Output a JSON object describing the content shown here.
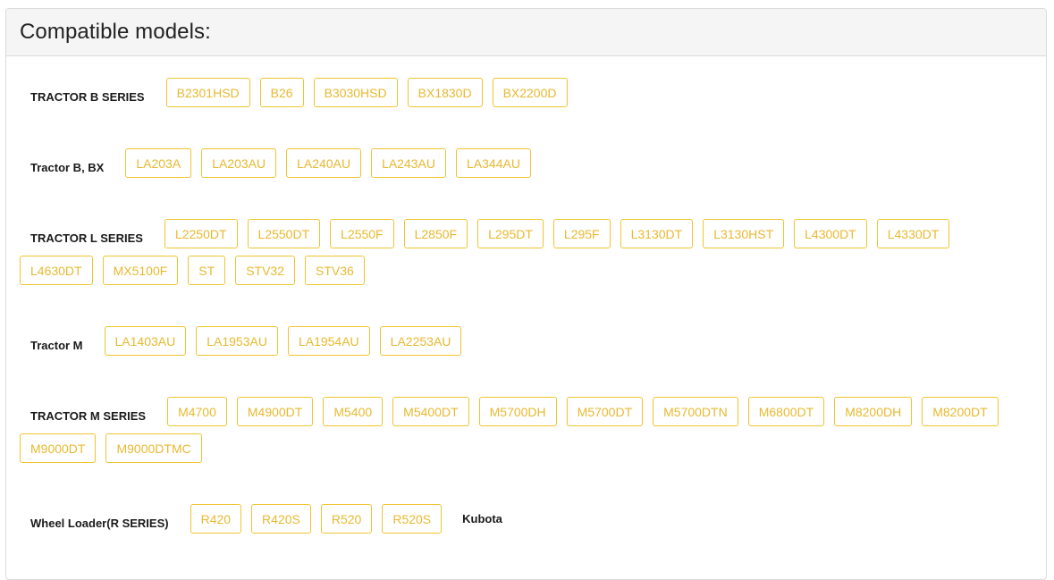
{
  "panel": {
    "title": "Compatible models:"
  },
  "series": [
    {
      "label": "TRACTOR B SERIES",
      "models": [
        "B2301HSD",
        "B26",
        "B3030HSD",
        "BX1830D",
        "BX2200D"
      ]
    },
    {
      "label": "Tractor B, BX",
      "models": [
        "LA203A",
        "LA203AU",
        "LA240AU",
        "LA243AU",
        "LA344AU"
      ]
    },
    {
      "label": "TRACTOR L SERIES",
      "models": [
        "L2250DT",
        "L2550DT",
        "L2550F",
        "L2850F",
        "L295DT",
        "L295F",
        "L3130DT",
        "L3130HST",
        "L4300DT",
        "L4330DT",
        "L4630DT",
        "MX5100F",
        "ST",
        "STV32",
        "STV36"
      ]
    },
    {
      "label": "Tractor M",
      "models": [
        "LA1403AU",
        "LA1953AU",
        "LA1954AU",
        "LA2253AU"
      ]
    },
    {
      "label": "TRACTOR M SERIES",
      "models": [
        "M4700",
        "M4900DT",
        "M5400",
        "M5400DT",
        "M5700DH",
        "M5700DT",
        "M5700DTN",
        "M6800DT",
        "M8200DH",
        "M8200DT",
        "M9000DT",
        "M9000DTMC"
      ]
    },
    {
      "label": "Wheel Loader(R SERIES)",
      "models": [
        "R420",
        "R420S",
        "R520",
        "R520S"
      ],
      "brand": "Kubota"
    }
  ],
  "colors": {
    "tag_border": "#f0c530",
    "tag_text": "#e8b930",
    "header_bg": "#f5f5f5"
  }
}
